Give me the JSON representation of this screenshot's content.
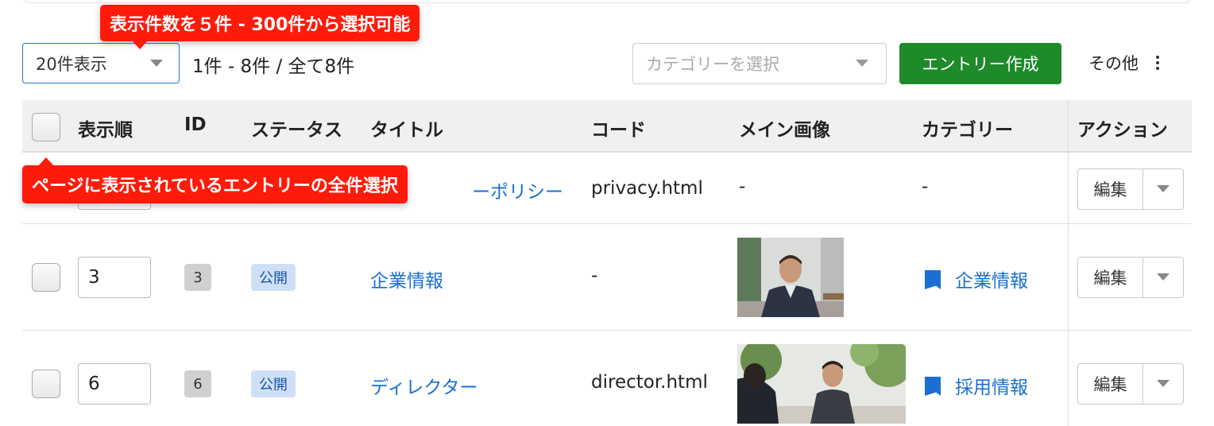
{
  "toolbar": {
    "per_page_value": "20件表示",
    "count_text": "1件 - 8件 / 全て8件",
    "category_placeholder": "カテゴリーを選択",
    "create_label": "エントリー作成",
    "more_label": "その他"
  },
  "tooltips": {
    "per_page": "表示件数を５件 - 300件から選択可能",
    "select_all": "ページに表示されているエントリーの全件選択"
  },
  "table": {
    "headers": {
      "order": "表示順",
      "id": "ID",
      "status": "ステータス",
      "title": "タイトル",
      "code": "コード",
      "image": "メイン画像",
      "category": "カテゴリー",
      "action": "アクション"
    },
    "rows": [
      {
        "title": "ーポリシー",
        "code": "privacy.html",
        "image": "-",
        "category": "-",
        "edit": "編集"
      },
      {
        "order": "3",
        "id": "3",
        "status": "公開",
        "title": "企業情報",
        "code": "-",
        "category": "企業情報",
        "edit": "編集"
      },
      {
        "order": "6",
        "id": "6",
        "status": "公開",
        "title": "ディレクター",
        "code": "director.html",
        "category": "採用情報",
        "edit": "編集"
      }
    ]
  },
  "colors": {
    "primary_blue": "#1a6fd0",
    "create_green": "#1e8a2a",
    "tooltip_red": "#ff1a0a",
    "status_bg": "#cfe0f6"
  }
}
